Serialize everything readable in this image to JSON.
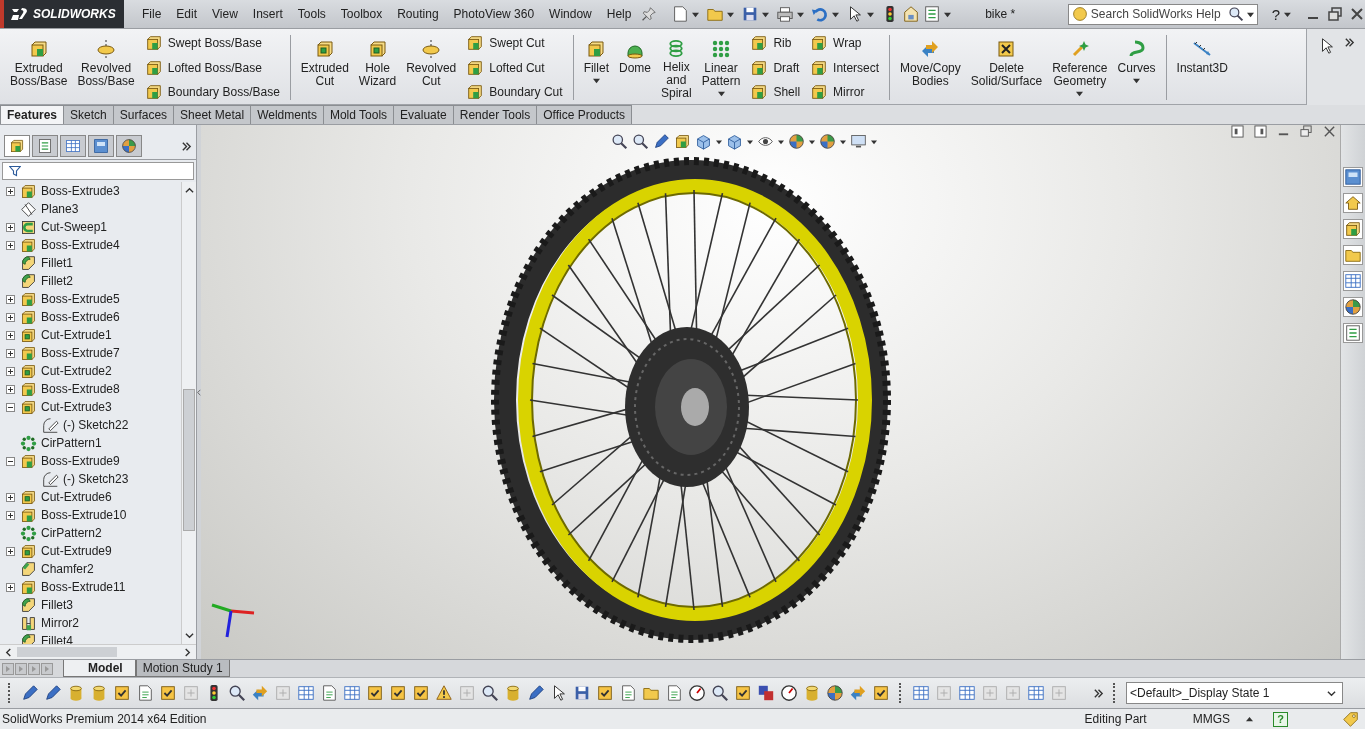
{
  "title_bar": {
    "brand": "SOLIDWORKS",
    "menu": [
      "File",
      "Edit",
      "View",
      "Insert",
      "Tools",
      "Toolbox",
      "Routing",
      "PhotoView 360",
      "Window",
      "Help"
    ],
    "document": "bike *",
    "search": {
      "placeholder": "Search SolidWorks Help"
    },
    "help": "?"
  },
  "ribbon": {
    "groups": [
      {
        "items": [
          {
            "kind": "large",
            "lines": [
              "Extruded",
              "Boss/Base"
            ],
            "dropdown": false
          },
          {
            "kind": "large",
            "lines": [
              "Revolved",
              "Boss/Base"
            ],
            "dropdown": false
          },
          {
            "kind": "stack",
            "rows": [
              "Swept Boss/Base",
              "Lofted Boss/Base",
              "Boundary Boss/Base"
            ]
          }
        ]
      },
      {
        "items": [
          {
            "kind": "large",
            "lines": [
              "Extruded",
              "Cut"
            ],
            "dropdown": false
          },
          {
            "kind": "large",
            "lines": [
              "Hole",
              "Wizard"
            ],
            "dropdown": false
          },
          {
            "kind": "large",
            "lines": [
              "Revolved",
              "Cut"
            ],
            "dropdown": false
          },
          {
            "kind": "stack",
            "rows": [
              "Swept Cut",
              "Lofted Cut",
              "Boundary Cut"
            ]
          }
        ]
      },
      {
        "items": [
          {
            "kind": "large",
            "lines": [
              "Fillet"
            ],
            "dropdown": true
          },
          {
            "kind": "large",
            "lines": [
              "Dome"
            ],
            "dropdown": false
          },
          {
            "kind": "large",
            "lines": [
              "Helix",
              "and",
              "Spiral"
            ],
            "dropdown": false
          },
          {
            "kind": "large",
            "lines": [
              "Linear",
              "Pattern"
            ],
            "dropdown": true
          },
          {
            "kind": "stack",
            "rows": [
              "Rib",
              "Draft",
              "Shell"
            ]
          },
          {
            "kind": "stack",
            "rows": [
              "Wrap",
              "Intersect",
              "Mirror"
            ]
          }
        ]
      },
      {
        "items": [
          {
            "kind": "large",
            "lines": [
              "Move/Copy",
              "Bodies"
            ],
            "dropdown": false
          },
          {
            "kind": "large",
            "lines": [
              "Delete",
              "Solid/Surface"
            ],
            "dropdown": false
          },
          {
            "kind": "large",
            "lines": [
              "Reference",
              "Geometry"
            ],
            "dropdown": true
          },
          {
            "kind": "large",
            "lines": [
              "Curves"
            ],
            "dropdown": true
          }
        ]
      },
      {
        "items": [
          {
            "kind": "large",
            "lines": [
              "Instant3D"
            ],
            "dropdown": false
          }
        ]
      }
    ]
  },
  "tabs": [
    {
      "label": "Features",
      "selected": true
    },
    {
      "label": "Sketch",
      "selected": false
    },
    {
      "label": "Surfaces",
      "selected": false
    },
    {
      "label": "Sheet Metal",
      "selected": false
    },
    {
      "label": "Weldments",
      "selected": false
    },
    {
      "label": "Mold Tools",
      "selected": false
    },
    {
      "label": "Evaluate",
      "selected": false
    },
    {
      "label": "Render Tools",
      "selected": false
    },
    {
      "label": "Office Products",
      "selected": false
    }
  ],
  "panel_tabs": [
    {
      "selected": true
    },
    {
      "selected": false
    },
    {
      "selected": false
    },
    {
      "selected": false
    },
    {
      "selected": false
    }
  ],
  "feature_tree": [
    {
      "label": "Boss-Extrude3",
      "kind": "boss",
      "expanded": false
    },
    {
      "label": "Plane3",
      "kind": "plane"
    },
    {
      "label": "Cut-Sweep1",
      "kind": "sweep",
      "expanded": false
    },
    {
      "label": "Boss-Extrude4",
      "kind": "boss",
      "expanded": false
    },
    {
      "label": "Fillet1",
      "kind": "fillet"
    },
    {
      "label": "Fillet2",
      "kind": "fillet"
    },
    {
      "label": "Boss-Extrude5",
      "kind": "boss",
      "expanded": false
    },
    {
      "label": "Boss-Extrude6",
      "kind": "boss",
      "expanded": false
    },
    {
      "label": "Cut-Extrude1",
      "kind": "cut",
      "expanded": false
    },
    {
      "label": "Boss-Extrude7",
      "kind": "boss",
      "expanded": false
    },
    {
      "label": "Cut-Extrude2",
      "kind": "cut",
      "expanded": false
    },
    {
      "label": "Boss-Extrude8",
      "kind": "boss",
      "expanded": false
    },
    {
      "label": "Cut-Extrude3",
      "kind": "cut",
      "expanded": true,
      "children": [
        {
          "label": "(-) Sketch22",
          "kind": "sketch"
        }
      ]
    },
    {
      "label": "CirPattern1",
      "kind": "pattern"
    },
    {
      "label": "Boss-Extrude9",
      "kind": "boss",
      "expanded": true,
      "children": [
        {
          "label": "(-) Sketch23",
          "kind": "sketch"
        }
      ]
    },
    {
      "label": "Cut-Extrude6",
      "kind": "cut",
      "expanded": false
    },
    {
      "label": "Boss-Extrude10",
      "kind": "boss",
      "expanded": false
    },
    {
      "label": "CirPattern2",
      "kind": "pattern"
    },
    {
      "label": "Cut-Extrude9",
      "kind": "cut",
      "expanded": false
    },
    {
      "label": "Chamfer2",
      "kind": "chamfer"
    },
    {
      "label": "Boss-Extrude11",
      "kind": "boss",
      "expanded": false
    },
    {
      "label": "Fillet3",
      "kind": "fillet"
    },
    {
      "label": "Mirror2",
      "kind": "mirror"
    },
    {
      "label": "Fillet4",
      "kind": "fillet"
    }
  ],
  "bottom_tabs": [
    {
      "label": "Model",
      "selected": true
    },
    {
      "label": "Motion Study 1",
      "selected": false
    }
  ],
  "display_state": "<Default>_Display State 1",
  "status_bar": {
    "edition": "SolidWorks Premium 2014 x64 Edition",
    "mode": "Editing Part",
    "units": "MMGS",
    "help": "?"
  }
}
